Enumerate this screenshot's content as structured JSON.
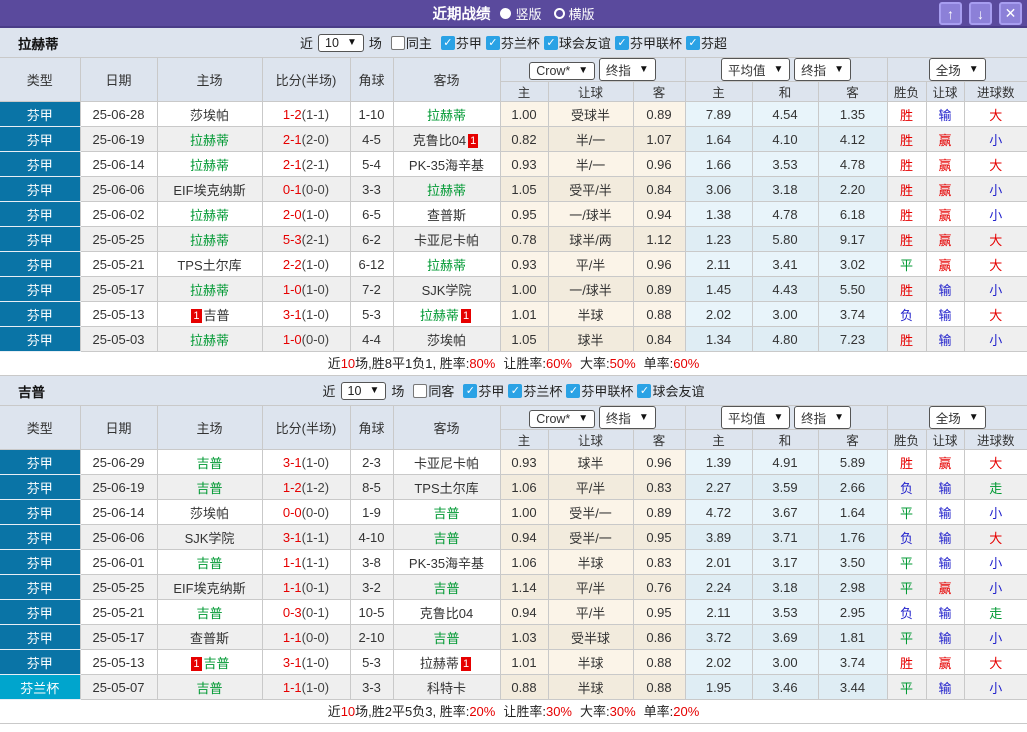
{
  "titlebar": {
    "title": "近期战绩",
    "radio_vertical": "竖版",
    "radio_horizontal": "横版",
    "selected": "竖版",
    "buttons": [
      {
        "name": "move-up",
        "glyph": "↑"
      },
      {
        "name": "move-down",
        "glyph": "↓"
      },
      {
        "name": "close",
        "glyph": "✕"
      }
    ]
  },
  "columns": {
    "left": [
      "类型",
      "日期",
      "主场",
      "比分(半场)",
      "角球",
      "客场"
    ],
    "dropdowns": [
      "Crow*",
      "终指",
      "平均值",
      "终指",
      "全场"
    ],
    "sub": [
      "主",
      "让球",
      "客",
      "主",
      "和",
      "客",
      "胜负",
      "让球",
      "进球数"
    ]
  },
  "colors": {
    "titlebar_purple": "#5a4a9d",
    "button_purple": "#8c80d8",
    "header_bg": "#dde4ee",
    "league_cell_blue": "#0a74a6",
    "cup_cell_cyan": "#00a5cd",
    "team_green": "#009933",
    "score_red": "#e60000",
    "lose_blue": "#2222cc",
    "checkbox_blue": "#2aa2e5",
    "odds_cream": "#fbf4e8",
    "avg_blue": "#e8f4fa"
  },
  "sections": [
    {
      "team": "拉赫蒂",
      "filter": {
        "near_label": "近",
        "games": "10",
        "games_label": "场",
        "same_label": "同主",
        "same_checked": false,
        "leagues": [
          {
            "label": "芬甲",
            "checked": true
          },
          {
            "label": "芬兰杯",
            "checked": true
          },
          {
            "label": "球会友谊",
            "checked": true
          },
          {
            "label": "芬甲联杯",
            "checked": true
          },
          {
            "label": "芬超",
            "checked": true
          }
        ]
      },
      "rows": [
        {
          "type": "芬甲",
          "cup": false,
          "date": "25-06-28",
          "home": "莎埃帕",
          "home_self": false,
          "home_badge": "",
          "score": "1-2",
          "half": "(1-1)",
          "corner": "1-10",
          "away": "拉赫蒂",
          "away_self": true,
          "away_badge": "",
          "odds": [
            "1.00",
            "受球半",
            "0.89"
          ],
          "avg": [
            "7.89",
            "4.54",
            "1.35"
          ],
          "results": [
            "胜",
            "输",
            "大"
          ]
        },
        {
          "type": "芬甲",
          "cup": false,
          "date": "25-06-19",
          "home": "拉赫蒂",
          "home_self": true,
          "home_badge": "",
          "score": "2-1",
          "half": "(2-0)",
          "corner": "4-5",
          "away": "克鲁比04",
          "away_self": false,
          "away_badge": "1",
          "odds": [
            "0.82",
            "半/一",
            "1.07"
          ],
          "avg": [
            "1.64",
            "4.10",
            "4.12"
          ],
          "results": [
            "胜",
            "赢",
            "小"
          ]
        },
        {
          "type": "芬甲",
          "cup": false,
          "date": "25-06-14",
          "home": "拉赫蒂",
          "home_self": true,
          "home_badge": "",
          "score": "2-1",
          "half": "(2-1)",
          "corner": "5-4",
          "away": "PK-35海辛基",
          "away_self": false,
          "away_badge": "",
          "odds": [
            "0.93",
            "半/一",
            "0.96"
          ],
          "avg": [
            "1.66",
            "3.53",
            "4.78"
          ],
          "results": [
            "胜",
            "赢",
            "大"
          ]
        },
        {
          "type": "芬甲",
          "cup": false,
          "date": "25-06-06",
          "home": "EIF埃克纳斯",
          "home_self": false,
          "home_badge": "",
          "score": "0-1",
          "half": "(0-0)",
          "corner": "3-3",
          "away": "拉赫蒂",
          "away_self": true,
          "away_badge": "",
          "odds": [
            "1.05",
            "受平/半",
            "0.84"
          ],
          "avg": [
            "3.06",
            "3.18",
            "2.20"
          ],
          "results": [
            "胜",
            "赢",
            "小"
          ]
        },
        {
          "type": "芬甲",
          "cup": false,
          "date": "25-06-02",
          "home": "拉赫蒂",
          "home_self": true,
          "home_badge": "",
          "score": "2-0",
          "half": "(1-0)",
          "corner": "6-5",
          "away": "查普斯",
          "away_self": false,
          "away_badge": "",
          "odds": [
            "0.95",
            "一/球半",
            "0.94"
          ],
          "avg": [
            "1.38",
            "4.78",
            "6.18"
          ],
          "results": [
            "胜",
            "赢",
            "小"
          ]
        },
        {
          "type": "芬甲",
          "cup": false,
          "date": "25-05-25",
          "home": "拉赫蒂",
          "home_self": true,
          "home_badge": "",
          "score": "5-3",
          "half": "(2-1)",
          "corner": "6-2",
          "away": "卡亚尼卡帕",
          "away_self": false,
          "away_badge": "",
          "odds": [
            "0.78",
            "球半/两",
            "1.12"
          ],
          "avg": [
            "1.23",
            "5.80",
            "9.17"
          ],
          "results": [
            "胜",
            "赢",
            "大"
          ]
        },
        {
          "type": "芬甲",
          "cup": false,
          "date": "25-05-21",
          "home": "TPS土尔库",
          "home_self": false,
          "home_badge": "",
          "score": "2-2",
          "half": "(1-0)",
          "corner": "6-12",
          "away": "拉赫蒂",
          "away_self": true,
          "away_badge": "",
          "odds": [
            "0.93",
            "平/半",
            "0.96"
          ],
          "avg": [
            "2.11",
            "3.41",
            "3.02"
          ],
          "results": [
            "平",
            "赢",
            "大"
          ]
        },
        {
          "type": "芬甲",
          "cup": false,
          "date": "25-05-17",
          "home": "拉赫蒂",
          "home_self": true,
          "home_badge": "",
          "score": "1-0",
          "half": "(1-0)",
          "corner": "7-2",
          "away": "SJK学院",
          "away_self": false,
          "away_badge": "",
          "odds": [
            "1.00",
            "一/球半",
            "0.89"
          ],
          "avg": [
            "1.45",
            "4.43",
            "5.50"
          ],
          "results": [
            "胜",
            "输",
            "小"
          ]
        },
        {
          "type": "芬甲",
          "cup": false,
          "date": "25-05-13",
          "home": "吉普",
          "home_self": false,
          "home_badge": "1",
          "score": "3-1",
          "half": "(1-0)",
          "corner": "5-3",
          "away": "拉赫蒂",
          "away_self": true,
          "away_badge": "1",
          "odds": [
            "1.01",
            "半球",
            "0.88"
          ],
          "avg": [
            "2.02",
            "3.00",
            "3.74"
          ],
          "results": [
            "负",
            "输",
            "大"
          ]
        },
        {
          "type": "芬甲",
          "cup": false,
          "date": "25-05-03",
          "home": "拉赫蒂",
          "home_self": true,
          "home_badge": "",
          "score": "1-0",
          "half": "(0-0)",
          "corner": "4-4",
          "away": "莎埃帕",
          "away_self": false,
          "away_badge": "",
          "odds": [
            "1.05",
            "球半",
            "0.84"
          ],
          "avg": [
            "1.34",
            "4.80",
            "7.23"
          ],
          "results": [
            "胜",
            "输",
            "小"
          ]
        }
      ],
      "summary": {
        "near": "近",
        "games": "10",
        "record": "场,胜8平1负1, 胜率:",
        "win_rate": "80%",
        "handicap_label": "让胜率:",
        "handicap_rate": "60%",
        "big_label": "大率:",
        "big_rate": "50%",
        "single_label": "单率:",
        "single_rate": "60%"
      }
    },
    {
      "team": "吉普",
      "filter": {
        "near_label": "近",
        "games": "10",
        "games_label": "场",
        "same_label": "同客",
        "same_checked": false,
        "leagues": [
          {
            "label": "芬甲",
            "checked": true
          },
          {
            "label": "芬兰杯",
            "checked": true
          },
          {
            "label": "芬甲联杯",
            "checked": true
          },
          {
            "label": "球会友谊",
            "checked": true
          }
        ]
      },
      "rows": [
        {
          "type": "芬甲",
          "cup": false,
          "date": "25-06-29",
          "home": "吉普",
          "home_self": true,
          "home_badge": "",
          "score": "3-1",
          "half": "(1-0)",
          "corner": "2-3",
          "away": "卡亚尼卡帕",
          "away_self": false,
          "away_badge": "",
          "odds": [
            "0.93",
            "球半",
            "0.96"
          ],
          "avg": [
            "1.39",
            "4.91",
            "5.89"
          ],
          "results": [
            "胜",
            "赢",
            "大"
          ]
        },
        {
          "type": "芬甲",
          "cup": false,
          "date": "25-06-19",
          "home": "吉普",
          "home_self": true,
          "home_badge": "",
          "score": "1-2",
          "half": "(1-2)",
          "corner": "8-5",
          "away": "TPS土尔库",
          "away_self": false,
          "away_badge": "",
          "odds": [
            "1.06",
            "平/半",
            "0.83"
          ],
          "avg": [
            "2.27",
            "3.59",
            "2.66"
          ],
          "results": [
            "负",
            "输",
            "走"
          ]
        },
        {
          "type": "芬甲",
          "cup": false,
          "date": "25-06-14",
          "home": "莎埃帕",
          "home_self": false,
          "home_badge": "",
          "score": "0-0",
          "half": "(0-0)",
          "corner": "1-9",
          "away": "吉普",
          "away_self": true,
          "away_badge": "",
          "odds": [
            "1.00",
            "受半/一",
            "0.89"
          ],
          "avg": [
            "4.72",
            "3.67",
            "1.64"
          ],
          "results": [
            "平",
            "输",
            "小"
          ]
        },
        {
          "type": "芬甲",
          "cup": false,
          "date": "25-06-06",
          "home": "SJK学院",
          "home_self": false,
          "home_badge": "",
          "score": "3-1",
          "half": "(1-1)",
          "corner": "4-10",
          "away": "吉普",
          "away_self": true,
          "away_badge": "",
          "odds": [
            "0.94",
            "受半/一",
            "0.95"
          ],
          "avg": [
            "3.89",
            "3.71",
            "1.76"
          ],
          "results": [
            "负",
            "输",
            "大"
          ]
        },
        {
          "type": "芬甲",
          "cup": false,
          "date": "25-06-01",
          "home": "吉普",
          "home_self": true,
          "home_badge": "",
          "score": "1-1",
          "half": "(1-1)",
          "corner": "3-8",
          "away": "PK-35海辛基",
          "away_self": false,
          "away_badge": "",
          "odds": [
            "1.06",
            "半球",
            "0.83"
          ],
          "avg": [
            "2.01",
            "3.17",
            "3.50"
          ],
          "results": [
            "平",
            "输",
            "小"
          ]
        },
        {
          "type": "芬甲",
          "cup": false,
          "date": "25-05-25",
          "home": "EIF埃克纳斯",
          "home_self": false,
          "home_badge": "",
          "score": "1-1",
          "half": "(0-1)",
          "corner": "3-2",
          "away": "吉普",
          "away_self": true,
          "away_badge": "",
          "odds": [
            "1.14",
            "平/半",
            "0.76"
          ],
          "avg": [
            "2.24",
            "3.18",
            "2.98"
          ],
          "results": [
            "平",
            "赢",
            "小"
          ]
        },
        {
          "type": "芬甲",
          "cup": false,
          "date": "25-05-21",
          "home": "吉普",
          "home_self": true,
          "home_badge": "",
          "score": "0-3",
          "half": "(0-1)",
          "corner": "10-5",
          "away": "克鲁比04",
          "away_self": false,
          "away_badge": "",
          "odds": [
            "0.94",
            "平/半",
            "0.95"
          ],
          "avg": [
            "2.11",
            "3.53",
            "2.95"
          ],
          "results": [
            "负",
            "输",
            "走"
          ]
        },
        {
          "type": "芬甲",
          "cup": false,
          "date": "25-05-17",
          "home": "查普斯",
          "home_self": false,
          "home_badge": "",
          "score": "1-1",
          "half": "(0-0)",
          "corner": "2-10",
          "away": "吉普",
          "away_self": true,
          "away_badge": "",
          "odds": [
            "1.03",
            "受半球",
            "0.86"
          ],
          "avg": [
            "3.72",
            "3.69",
            "1.81"
          ],
          "results": [
            "平",
            "输",
            "小"
          ]
        },
        {
          "type": "芬甲",
          "cup": false,
          "date": "25-05-13",
          "home": "吉普",
          "home_self": true,
          "home_badge": "1",
          "score": "3-1",
          "half": "(1-0)",
          "corner": "5-3",
          "away": "拉赫蒂",
          "away_self": false,
          "away_badge": "1",
          "odds": [
            "1.01",
            "半球",
            "0.88"
          ],
          "avg": [
            "2.02",
            "3.00",
            "3.74"
          ],
          "results": [
            "胜",
            "赢",
            "大"
          ]
        },
        {
          "type": "芬兰杯",
          "cup": true,
          "date": "25-05-07",
          "home": "吉普",
          "home_self": true,
          "home_badge": "",
          "score": "1-1",
          "half": "(1-0)",
          "corner": "3-3",
          "away": "科特卡",
          "away_self": false,
          "away_badge": "",
          "odds": [
            "0.88",
            "半球",
            "0.88"
          ],
          "avg": [
            "1.95",
            "3.46",
            "3.44"
          ],
          "results": [
            "平",
            "输",
            "小"
          ]
        }
      ],
      "summary": {
        "near": "近",
        "games": "10",
        "record": "场,胜2平5负3, 胜率:",
        "win_rate": "20%",
        "handicap_label": "让胜率:",
        "handicap_rate": "30%",
        "big_label": "大率:",
        "big_rate": "30%",
        "single_label": "单率:",
        "single_rate": "20%"
      }
    }
  ]
}
